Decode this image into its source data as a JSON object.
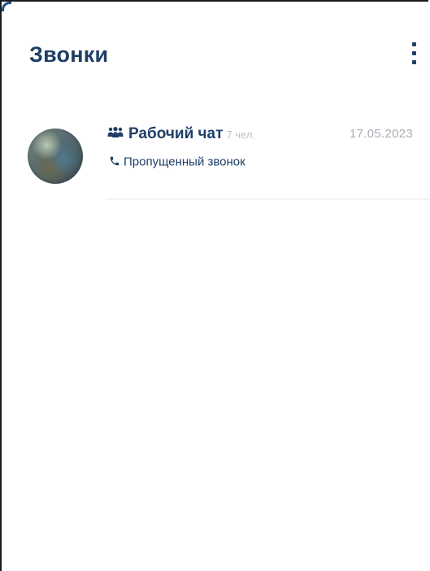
{
  "header": {
    "title": "Звонки",
    "menu_icon": "more-vertical-icon"
  },
  "calls": [
    {
      "avatar_icon": "group-avatar",
      "type_icon": "group-icon",
      "name": "Рабочий чат",
      "members": "7 чел.",
      "date": "17.05.2023",
      "status_icon": "phone-icon",
      "status": "Пропущенный звонок"
    }
  ],
  "colors": {
    "title": "#1f3f66",
    "muted": "#a8aeb5",
    "members": "#bcc3cb",
    "divider": "#f1f3f5"
  }
}
